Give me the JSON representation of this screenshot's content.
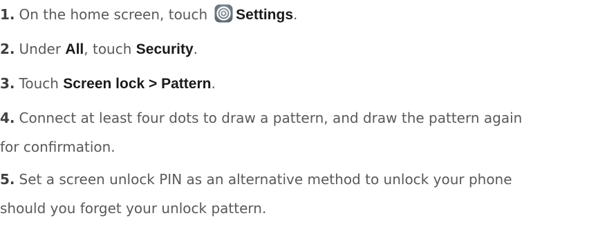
{
  "steps": [
    {
      "num": "1.",
      "pre": "On the home screen, touch",
      "icon": "settings-icon",
      "bold": "Settings",
      "post": "."
    },
    {
      "num": "2.",
      "pre": "Under ",
      "bold1": "All",
      "mid": ", touch ",
      "bold2": "Security",
      "post": "."
    },
    {
      "num": "3.",
      "pre": "Touch ",
      "bold": "Screen lock > Pattern",
      "post": "."
    },
    {
      "num": "4.",
      "line1": "Connect at least four dots to draw a pattern, and draw the pattern again",
      "line2": "for confirmation."
    },
    {
      "num": "5.",
      "line1": "Set a screen unlock PIN as an alternative method to unlock your phone",
      "line2": "should you forget your unlock pattern."
    }
  ]
}
